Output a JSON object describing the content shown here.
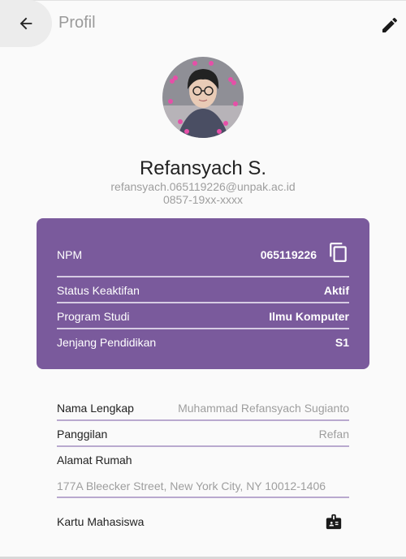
{
  "appbar": {
    "title": "Profil",
    "back_icon": "arrow-left-icon",
    "edit_icon": "pencil-icon"
  },
  "profile": {
    "name": "Refansyach S.",
    "email": "refansyach.065119226@unpak.ac.id",
    "phone": "0857-19xx-xxxx"
  },
  "academic_card": {
    "npm_label": "NPM",
    "npm_value": "065119226",
    "copy_icon": "copy-icon",
    "rows": [
      {
        "label": "Status Keaktifan",
        "value": "Aktif"
      },
      {
        "label": "Program Studi",
        "value": "Ilmu Komputer"
      },
      {
        "label": "Jenjang Pendidikan",
        "value": "S1"
      }
    ]
  },
  "personal": {
    "full_name_label": "Nama Lengkap",
    "full_name_value": "Muhammad Refansyach Sugianto",
    "nickname_label": "Panggilan",
    "nickname_value": "Refan",
    "address_label": "Alamat Rumah",
    "address_value": "177A Bleecker Street, New York City, NY 10012-1406",
    "student_card_label": "Kartu Mahasiswa",
    "student_card_icon": "id-card-icon"
  },
  "colors": {
    "card_bg": "#7a5a9c",
    "divider": "#b9a9cf",
    "muted_text": "#9e9e9e"
  }
}
